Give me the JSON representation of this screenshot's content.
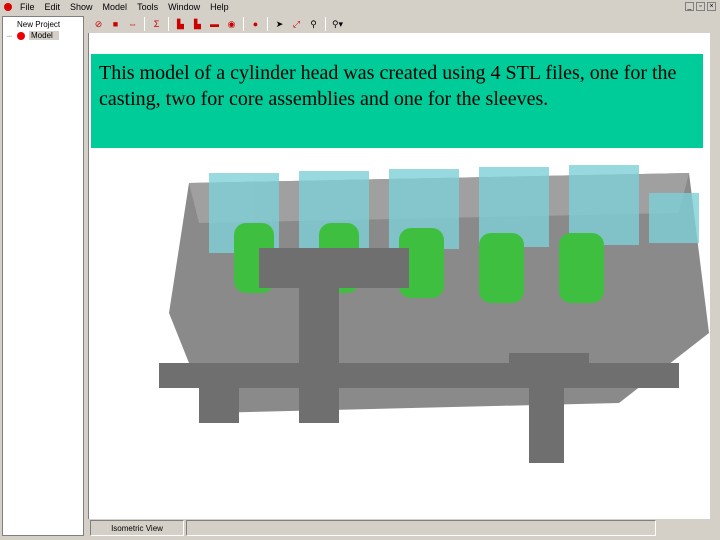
{
  "menu": [
    "File",
    "Edit",
    "Show",
    "Model",
    "Tools",
    "Window",
    "Help"
  ],
  "tree": {
    "root": "New Project",
    "child": "Model"
  },
  "toolbar": [
    "no-entry-icon",
    "stop-icon",
    "move-icon",
    "sigma-icon",
    "bar-chart-icon",
    "bar-chart-2-icon",
    "display-icon",
    "target-icon",
    "apple-icon",
    "pointer-icon",
    "connect-icon",
    "zoom-icon",
    "zoom-dropdown-icon"
  ],
  "banner": {
    "text": "This model of a cylinder head was created using 4 STL files, one for the casting, two for core assemblies and one for the sleeves."
  },
  "status": {
    "view": "Isometric View"
  },
  "colors": {
    "banner": "#00cc99",
    "casting": "#8a8a8a",
    "core": "#7fd0d8",
    "sleeve": "#3fbf3f"
  }
}
